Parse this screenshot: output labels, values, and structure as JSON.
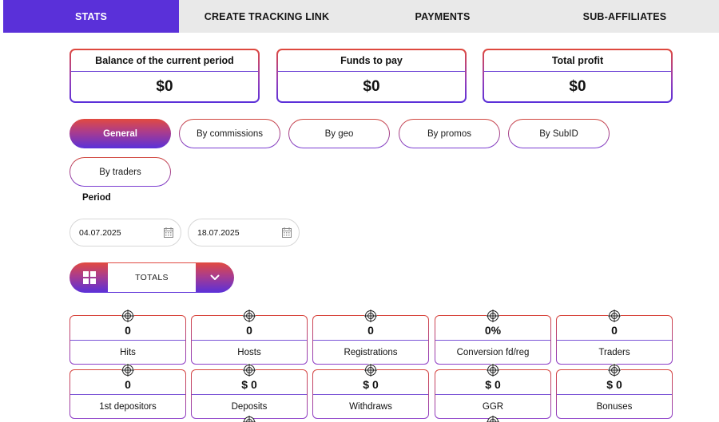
{
  "nav": {
    "tabs": [
      {
        "label": "STATS",
        "active": true
      },
      {
        "label": "CREATE TRACKING LINK",
        "active": false
      },
      {
        "label": "PAYMENTS",
        "active": false
      },
      {
        "label": "SUB-AFFILIATES",
        "active": false
      }
    ]
  },
  "summary": [
    {
      "title": "Balance of the current period",
      "value": "$0"
    },
    {
      "title": "Funds to pay",
      "value": "$0"
    },
    {
      "title": "Total profit",
      "value": "$0"
    }
  ],
  "filters": [
    "General",
    "By commissions",
    "By geo",
    "By promos",
    "By SubID",
    "By traders"
  ],
  "active_filter": "General",
  "period": {
    "label": "Period",
    "from": "04.07.2025",
    "to": "18.07.2025"
  },
  "view_selector": {
    "value": "TOTALS"
  },
  "stats": [
    {
      "value": "0",
      "label": "Hits"
    },
    {
      "value": "0",
      "label": "Hosts"
    },
    {
      "value": "0",
      "label": "Registrations"
    },
    {
      "value": "0%",
      "label": "Conversion fd/reg"
    },
    {
      "value": "0",
      "label": "Traders"
    },
    {
      "value": "0",
      "label": "1st depositors"
    },
    {
      "value": "$ 0",
      "label": "Deposits"
    },
    {
      "value": "$ 0",
      "label": "Withdraws"
    },
    {
      "value": "$ 0",
      "label": "GGR"
    },
    {
      "value": "$ 0",
      "label": "Bonuses"
    }
  ],
  "colors": {
    "accent": "#5a30d9",
    "gradient_start": "#e24a3f",
    "gradient_end": "#5a30d9"
  }
}
